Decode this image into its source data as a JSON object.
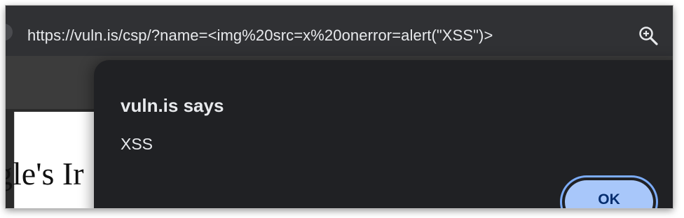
{
  "browser": {
    "url": "https://vuln.is/csp/?name=<img%20src=x%20onerror=alert(\"XSS\")>",
    "zoom_icon": "zoom-in-icon"
  },
  "page": {
    "heading_fragment": "gle's Ir"
  },
  "dialog": {
    "title": "vuln.is says",
    "message": "XSS",
    "ok_label": "OK"
  },
  "colors": {
    "dialog_background": "#202124",
    "ok_button": "#a8c7fa",
    "ok_text": "#062e6f",
    "focus_ring": "#7cacf8"
  }
}
